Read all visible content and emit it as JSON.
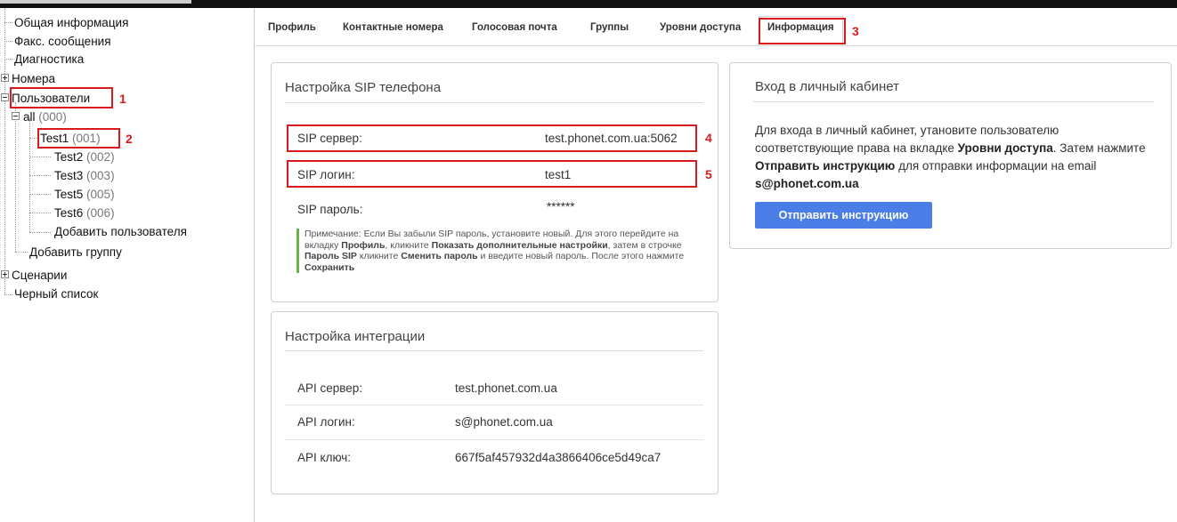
{
  "sidebar": {
    "general_info": "Общая информация",
    "fax_messages": "Факс. сообщения",
    "diagnostics": "Диагностика",
    "numbers": "Номера",
    "users": "Пользователи",
    "group_all": {
      "name": "all",
      "code": "(000)"
    },
    "users_list": [
      {
        "name": "Test1",
        "code": "(001)"
      },
      {
        "name": "Test2",
        "code": "(002)"
      },
      {
        "name": "Test3",
        "code": "(003)"
      },
      {
        "name": "Test5",
        "code": "(005)"
      },
      {
        "name": "Test6",
        "code": "(006)"
      }
    ],
    "add_user": "Добавить пользователя",
    "add_group": "Добавить группу",
    "scenarios": "Сценарии",
    "blacklist": "Черный список"
  },
  "tabs": [
    "Профиль",
    "Контактные номера",
    "Голосовая почта",
    "Группы",
    "Уровни доступа",
    "Информация"
  ],
  "annotations": [
    "1",
    "2",
    "3",
    "4",
    "5"
  ],
  "sip_panel": {
    "title": "Настройка SIP телефона",
    "server_label": "SIP сервер:",
    "server_value": "test.phonet.com.ua:5062",
    "login_label": "SIP логин:",
    "login_value": "test1",
    "password_label": "SIP пароль:",
    "password_value": "******",
    "note": {
      "p1": "Примечание: Если Вы забыли SIP пароль, установите новый. Для этого перейдите на вкладку ",
      "b1": "Профиль",
      "p2": ", кликните ",
      "b2": "Показать дополнительные настройки",
      "p3": ", затем в строчке ",
      "b3": "Пароль SIP",
      "p4": " кликните ",
      "b4": "Сменить пароль",
      "p5": " и введите новый пароль. После этого нажмите ",
      "b5": "Сохранить"
    }
  },
  "integration_panel": {
    "title": "Настройка интеграции",
    "rows": [
      {
        "label": "API сервер:",
        "value": "test.phonet.com.ua"
      },
      {
        "label": "API логин:",
        "value": "s@phonet.com.ua"
      },
      {
        "label": "API ключ:",
        "value": "667f5af457932d4a3866406ce5d49ca7"
      }
    ]
  },
  "cabinet_panel": {
    "title": "Вход в личный кабинет",
    "t1": "Для входа в личный кабинет, утановите пользователю соответствующие права на вкладке ",
    "b1": "Уровни доступа",
    "t2": ". Затем нажмите ",
    "b2": "Отправить инструкцию",
    "t3": " для отправки информации на email ",
    "b3": "s@phonet.com.ua",
    "button": "Отправить инструкцию"
  },
  "colors": {
    "accent_button": "#4a7ee6",
    "annotation_red": "#d9191c",
    "note_bar": "#6ab04c"
  }
}
